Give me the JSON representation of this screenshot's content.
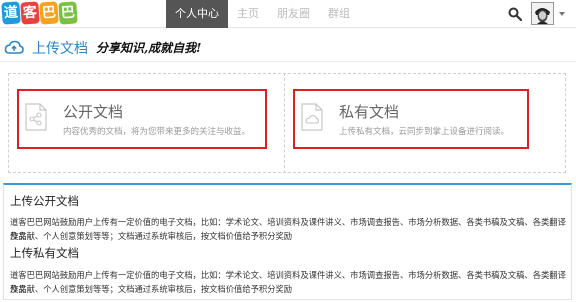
{
  "logo": {
    "chars": [
      "道",
      "客",
      "巴",
      "巴"
    ],
    "colors": [
      "#1c9be0",
      "#e9423e",
      "#f6a21d",
      "#7ac143"
    ]
  },
  "nav": {
    "items": [
      {
        "label": "个人中心",
        "active": true
      },
      {
        "label": "主页",
        "active": false
      },
      {
        "label": "朋友圈",
        "active": false
      },
      {
        "label": "群组",
        "active": false
      }
    ]
  },
  "header": {
    "search_icon": "search-icon",
    "avatar_icon": "user-avatar"
  },
  "upload": {
    "title": "上传文档",
    "slogan": "分享知识,成就自我!",
    "accent": "#2a87c8"
  },
  "cards": [
    {
      "title": "公开文档",
      "desc": "内容优秀的文档，将为您带来更多的关注与收益。",
      "icon": "share-document-icon"
    },
    {
      "title": "私有文档",
      "desc": "上传私有文档，云同步到掌上设备进行阅读。",
      "icon": "cloud-document-icon"
    }
  ],
  "info": {
    "public_heading": "上传公开文档",
    "public_text_1": "道客巴巴网站鼓励用户上传有一定价值的电子文档，比如：学术论文、培训资料及课件讲义、市场调查报告、市场分析数据、各类书稿及文稿、各类翻译作品",
    "public_text_2": "及文献、个人创意策划等等；文档通过系统审核后，按文档价值给予积分奖励",
    "private_heading": "上传私有文档",
    "private_text_1": "道客巴巴网站鼓励用户上传有一定价值的电子文档，比如：学术论文、培训资料及课件讲义、市场调查报告、市场分析数据、各类书稿及文稿、各类翻译作品",
    "private_text_2": "及文献、个人创意策划等等；文档通过系统审核后，按文档价值给予积分奖励"
  }
}
